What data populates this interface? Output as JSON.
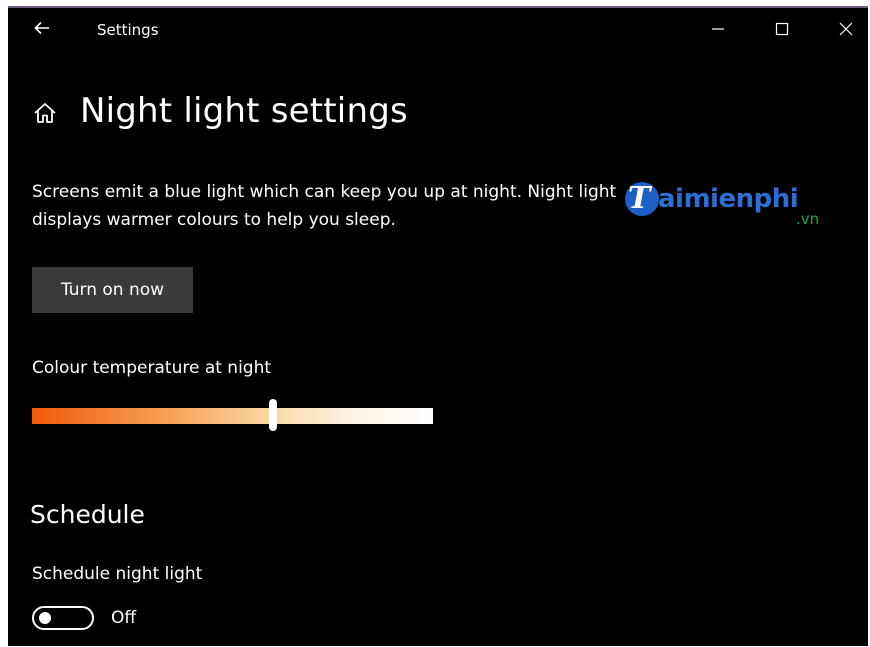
{
  "window": {
    "title": "Settings",
    "icons": {
      "back": "back-arrow-icon",
      "minimize": "minimize-icon",
      "maximize": "maximize-icon",
      "close": "close-icon"
    }
  },
  "page": {
    "title": "Night light settings",
    "home_icon": "home-icon",
    "description": "Screens emit a blue light which can keep you up at night. Night light displays warmer colours to help you sleep."
  },
  "actions": {
    "turn_on_label": "Turn on now"
  },
  "colour_temperature": {
    "label": "Colour temperature at night",
    "level": 0.6,
    "gradient_colors": [
      "#f05a0a",
      "#f7a35a",
      "#fbd9a6",
      "#ffffff"
    ]
  },
  "schedule": {
    "heading": "Schedule",
    "toggle_label": "Schedule night light",
    "state": "Off",
    "enabled": false
  },
  "watermark": {
    "brand": "Taimienphi",
    "suffix": ".vn",
    "colors": {
      "primary": "#1e5fc6",
      "suffix": "#2aa336"
    }
  },
  "theme": {
    "background": "#000000",
    "text": "#ffffff",
    "button_bg": "#3a3a3a"
  }
}
